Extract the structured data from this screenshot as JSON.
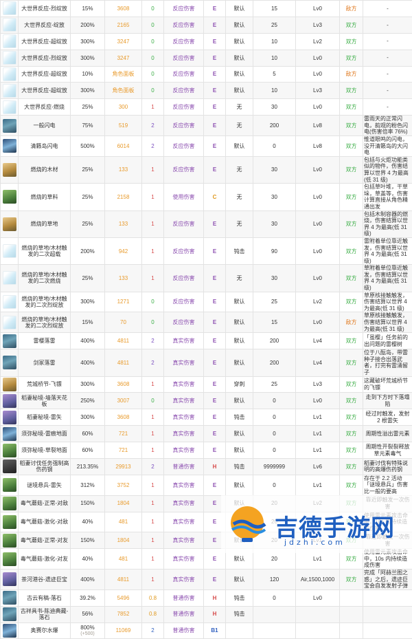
{
  "rows": [
    {
      "icon": "w",
      "name": "大世界反应-烈绽放",
      "pct": "15%",
      "base": "3608",
      "gauge": "0",
      "gauge_color": "green",
      "dur": "反应伤害",
      "elem": "E",
      "label": "默认",
      "val": "15",
      "lv": "Lv0",
      "side": "敌方",
      "side_enemy": true,
      "desc": "-",
      "desc_center": true
    },
    {
      "icon": "w",
      "name": "大世界反应-绽放",
      "pct": "200%",
      "base": "2165",
      "gauge": "0",
      "gauge_color": "green",
      "dur": "反应伤害",
      "elem": "E",
      "label": "默认",
      "val": "25",
      "lv": "Lv3",
      "side": "双方",
      "side_enemy": false,
      "desc": "-",
      "desc_center": true
    },
    {
      "icon": "w",
      "name": "大世界反应-超绽放",
      "pct": "300%",
      "base": "3247",
      "gauge": "0",
      "gauge_color": "green",
      "dur": "反应伤害",
      "elem": "E",
      "label": "默认",
      "val": "10",
      "lv": "Lv2",
      "side": "双方",
      "side_enemy": false,
      "desc": "-",
      "desc_center": true
    },
    {
      "icon": "w",
      "name": "大世界反应-烈绽放",
      "pct": "300%",
      "base": "3247",
      "gauge": "0",
      "gauge_color": "green",
      "dur": "反应伤害",
      "elem": "E",
      "label": "默认",
      "val": "10",
      "lv": "Lv0",
      "side": "双方",
      "side_enemy": false,
      "desc": "-",
      "desc_center": true
    },
    {
      "icon": "w",
      "name": "大世界反应-超绽放",
      "pct": "10%",
      "base": "角色面板",
      "gauge": "0",
      "gauge_color": "green",
      "dur": "反应伤害",
      "elem": "E",
      "label": "默认",
      "val": "5",
      "lv": "Lv0",
      "side": "敌方",
      "side_enemy": true,
      "desc": "-",
      "desc_center": true
    },
    {
      "icon": "w",
      "name": "大世界反应-超绽放",
      "pct": "300%",
      "base": "角色面板",
      "gauge": "0",
      "gauge_color": "green",
      "dur": "反应伤害",
      "elem": "E",
      "label": "默认",
      "val": "10",
      "lv": "Lv3",
      "side": "双方",
      "side_enemy": false,
      "desc": "-",
      "desc_center": true
    },
    {
      "icon": "w",
      "name": "大世界反应-燃烧",
      "pct": "25%",
      "base": "300",
      "gauge": "1",
      "gauge_color": "red",
      "dur": "反应伤害",
      "elem": "E",
      "label": "无",
      "val": "30",
      "lv": "Lv0",
      "side": "双方",
      "side_enemy": false,
      "desc": "-",
      "desc_center": true
    },
    {
      "icon": "d",
      "name": "一般闪电",
      "pct": "75%",
      "base": "519",
      "gauge": "2",
      "gauge_color": "purple",
      "dur": "反应伤害",
      "elem": "E",
      "label": "无",
      "val": "200",
      "lv": "Lv8",
      "side": "双方",
      "side_enemy": false,
      "desc": "雷雨天的正常闪电，韵观的粉色闪电(伤害倍率 76%)",
      "desc_center": false
    },
    {
      "icon": "b",
      "name": "清籁岛闪电",
      "pct": "500%",
      "base": "6014",
      "gauge": "2",
      "gauge_color": "purple",
      "dur": "反应伤害",
      "elem": "E",
      "label": "默认",
      "val": "0",
      "lv": "Lv8",
      "side": "双方",
      "side_enemy": false,
      "desc": "惟道眼鸣的闪电，没开清籁岛的大闪电",
      "desc_center": false
    },
    {
      "icon": "t",
      "name": "燃烧的木材",
      "pct": "25%",
      "base": "133",
      "gauge": "1",
      "gauge_color": "red",
      "dur": "反应伤害",
      "elem": "E",
      "label": "无",
      "val": "30",
      "lv": "Lv0",
      "side": "双方",
      "side_enemy": false,
      "desc": "包括与火炬功能类似的物件，伤害结算以世界 4 为最高(低 31 级)",
      "desc_center": false
    },
    {
      "icon": "g",
      "name": "燃烧的草料",
      "pct": "25%",
      "base": "2158",
      "gauge": "1",
      "gauge_color": "red",
      "dur": "使用伤害",
      "elem": "C",
      "label": "无",
      "val": "30",
      "lv": "Lv0",
      "side": "双方",
      "side_enemy": false,
      "desc": "包括草叶堆，干草垛，草盖等，伤害计算直接从角色精通出发",
      "desc_center": false
    },
    {
      "icon": "t",
      "name": "燃烧的草地",
      "pct": "25%",
      "base": "133",
      "gauge": "1",
      "gauge_color": "red",
      "dur": "反应伤害",
      "elem": "E",
      "label": "无",
      "val": "30",
      "lv": "Lv0",
      "side": "双方",
      "side_enemy": false,
      "desc": "包括木制容器的燃烧，伤害结算以世界 4 为最高(低 31 级)",
      "desc_center": false
    },
    {
      "icon": "w",
      "name": "燃烧的草地/木材触发的二次超载",
      "pct": "200%",
      "base": "942",
      "gauge": "1",
      "gauge_color": "red",
      "dur": "反应伤害",
      "elem": "E",
      "label": "钝击",
      "val": "90",
      "lv": "Lv0",
      "side": "双方",
      "side_enemy": false,
      "desc": "雷附着单位靠近触发，伤害结算以世界 4 为最高(低 31 级)",
      "desc_center": false
    },
    {
      "icon": "w",
      "name": "燃烧的草地/木材触发的二次燃烧",
      "pct": "25%",
      "base": "133",
      "gauge": "1",
      "gauge_color": "red",
      "dur": "反应伤害",
      "elem": "E",
      "label": "无",
      "val": "30",
      "lv": "Lv0",
      "side": "双方",
      "side_enemy": false,
      "desc": "草附着单位靠近触发，伤害结算以世界 4 为最高(低 31 级)",
      "desc_center": false
    },
    {
      "icon": "w",
      "name": "燃烧的草地/木材触发的二次烈绽放",
      "pct": "300%",
      "base": "1271",
      "gauge": "0",
      "gauge_color": "green",
      "dur": "反应伤害",
      "elem": "E",
      "label": "默认",
      "val": "25",
      "lv": "Lv2",
      "side": "双方",
      "side_enemy": false,
      "desc": "草原核接触触发，伤害结算以世界 4 为最高(低 31 级)",
      "desc_center": false
    },
    {
      "icon": "w",
      "name": "燃烧的草地/木材触发的二次烈绽放",
      "pct": "15%",
      "base": "70",
      "gauge": "0",
      "gauge_color": "green",
      "dur": "反应伤害",
      "elem": "E",
      "label": "默认",
      "val": "15",
      "lv": "Lv0",
      "side": "敌方",
      "side_enemy": true,
      "desc": "草原核接触触发，伤害结算以世界 4 为最高(低 31 级)",
      "desc_center": false
    },
    {
      "icon": "d",
      "name": "雷樱落雷",
      "pct": "400%",
      "base": "4811",
      "gauge": "2",
      "gauge_color": "purple",
      "dur": "真实伤害",
      "elem": "E",
      "label": "默认",
      "val": "200",
      "lv": "Lv4",
      "side": "双方",
      "side_enemy": false,
      "desc": "「虽樱」任务前的出问题的雷樱树",
      "desc_center": false
    },
    {
      "icon": "d",
      "name": "剑冢落雷",
      "pct": "400%",
      "base": "4811",
      "gauge": "2",
      "gauge_color": "purple",
      "dur": "真实伤害",
      "elem": "E",
      "label": "默认",
      "val": "200",
      "lv": "Lv4",
      "side": "双方",
      "side_enemy": false,
      "desc": "位于八酝岛，带雷种子接合出落武者，打完有雷涌留子",
      "desc_center": false
    },
    {
      "icon": "t",
      "name": "荒城桥节-飞镖",
      "pct": "300%",
      "base": "3608",
      "gauge": "1",
      "gauge_color": "red",
      "dur": "真实伤害",
      "elem": "E",
      "label": "穿刺",
      "val": "25",
      "lv": "Lv3",
      "side": "双方",
      "side_enemy": false,
      "desc": "这藏破坏荒城桥节的飞镖",
      "desc_center": false
    },
    {
      "icon": "p",
      "name": "稻妻秘境-墙落天花板",
      "pct": "250%",
      "base": "3007",
      "gauge": "0",
      "gauge_color": "green",
      "dur": "真实伤害",
      "elem": "E",
      "label": "默认",
      "val": "0",
      "lv": "Lv0",
      "side": "双方",
      "side_enemy": false,
      "desc": "走到下方时下落塌陷",
      "desc_center": true
    },
    {
      "icon": "p",
      "name": "稻妻秘境-雷矢",
      "pct": "300%",
      "base": "3608",
      "gauge": "1",
      "gauge_color": "red",
      "dur": "真实伤害",
      "elem": "E",
      "label": "钝击",
      "val": "0",
      "lv": "Lv1",
      "side": "双方",
      "side_enemy": false,
      "desc": "经过时触发，发射 2 根雷矢",
      "desc_center": true
    },
    {
      "icon": "b",
      "name": "须弥秘境-雷痕地面",
      "pct": "60%",
      "base": "721",
      "gauge": "1",
      "gauge_color": "red",
      "dur": "真实伤害",
      "elem": "E",
      "label": "默认",
      "val": "0",
      "lv": "Lv1",
      "side": "双方",
      "side_enemy": false,
      "desc": "周期性溢出雷元素",
      "desc_center": true
    },
    {
      "icon": "g",
      "name": "须弥秘境-草裂地面",
      "pct": "60%",
      "base": "721",
      "gauge": "1",
      "gauge_color": "red",
      "dur": "真实伤害",
      "elem": "E",
      "label": "默认",
      "val": "0",
      "lv": "Lv1",
      "side": "双方",
      "side_enemy": false,
      "desc": "周期性开裂裂释放草元素毒气",
      "desc_center": true
    },
    {
      "icon": "k",
      "name": "稻妻讨伐任务强制高伤药钢",
      "pct": "213.35%",
      "base": "29913",
      "gauge": "2",
      "gauge_color": "purple",
      "dur": "普通伤害",
      "elem": "H",
      "label": "钝击",
      "val": "9999999",
      "lv": "Lv6",
      "side": "双方",
      "side_enemy": false,
      "desc": "稻妻讨伐有特殊说明的高爆伤药钢",
      "desc_center": false
    },
    {
      "icon": "g",
      "name": "谜境悬兵-雷矢",
      "pct": "312%",
      "base": "3752",
      "gauge": "1",
      "gauge_color": "red",
      "dur": "真实伤害",
      "elem": "E",
      "label": "默认",
      "val": "0",
      "lv": "Lv1",
      "side": "双方",
      "side_enemy": false,
      "desc": "存在于 2.2 活动「谜境悬兵」伤害比一般的要高",
      "desc_center": false
    },
    {
      "icon": "g",
      "name": "毒气蘑菇-正常-对敌",
      "pct": "150%",
      "base": "1804",
      "gauge": "1",
      "gauge_color": "red",
      "dur": "真实伤害",
      "elem": "E",
      "label": "默认",
      "val": "20",
      "lv": "Lv2",
      "side": "双方",
      "side_enemy": false,
      "desc": "靠近即触发一次伤害",
      "desc_center": true
    },
    {
      "icon": "g",
      "name": "毒气蘑菇-激化-对敌",
      "pct": "40%",
      "base": "481",
      "gauge": "1",
      "gauge_color": "red",
      "dur": "真实伤害",
      "elem": "E",
      "label": "默认",
      "val": "20",
      "lv": "Lv2",
      "side": "双方",
      "side_enemy": false,
      "desc": "使用雷元素攻击命中，10s 内持续造成伤害",
      "desc_center": false
    },
    {
      "icon": "g",
      "name": "毒气蘑菇-正常-对友",
      "pct": "150%",
      "base": "1804",
      "gauge": "1",
      "gauge_color": "red",
      "dur": "真实伤害",
      "elem": "E",
      "label": "默认",
      "val": "20",
      "lv": "Lv1",
      "side": "双方",
      "side_enemy": false,
      "desc": "靠近即触发一次伤害",
      "desc_center": true
    },
    {
      "icon": "g",
      "name": "毒气蘑菇-激化-对友",
      "pct": "40%",
      "base": "481",
      "gauge": "1",
      "gauge_color": "red",
      "dur": "真实伤害",
      "elem": "E",
      "label": "默认",
      "val": "20",
      "lv": "Lv1",
      "side": "双方",
      "side_enemy": false,
      "desc": "使用雷元素攻击命中，10s 内持续造成伤害",
      "desc_center": false
    },
    {
      "icon": "p",
      "name": "茶河港谷-遗迹巨宝",
      "pct": "400%",
      "base": "4811",
      "gauge": "1",
      "gauge_color": "red",
      "dur": "真实伤害",
      "elem": "E",
      "label": "默认",
      "val": "120",
      "lv": "Air,1500,1000",
      "side": "双方",
      "side_enemy": false,
      "desc": "完成「阿赫兰图之惑」之后，遗迹巨宝会自发发射子弹",
      "desc_center": false
    },
    {
      "icon": "d",
      "name": "古云有稿-落石",
      "pct": "39.2%",
      "base": "5496",
      "gauge": "0.8",
      "gauge_color": "orange",
      "dur": "普通伤害",
      "elem": "H",
      "label": "钝击",
      "val": "0",
      "lv": "Lv0",
      "side": "",
      "side_enemy": false,
      "desc": "",
      "desc_center": false
    },
    {
      "icon": "d",
      "name": "古祥具书-陈迪典藏-落石",
      "pct": "56%",
      "base": "7852",
      "gauge": "0.8",
      "gauge_color": "orange",
      "dur": "普通伤害",
      "elem": "H",
      "label": "钝击",
      "val": "",
      "lv": "",
      "side": "",
      "side_enemy": false,
      "desc": "",
      "desc_center": false
    },
    {
      "icon": "b",
      "name": "奥赛尔水爆",
      "pct": "800%",
      "pct_sub": "(+500)",
      "base": "11069",
      "gauge": "2",
      "gauge_color": "blue",
      "dur": "普通伤害",
      "elem": "B1",
      "label": "",
      "val": "",
      "lv": "",
      "side": "",
      "side_enemy": false,
      "desc": "",
      "desc_center": false
    }
  ],
  "watermark": {
    "text": "吉德手游网",
    "url": "jdzhi.com"
  }
}
